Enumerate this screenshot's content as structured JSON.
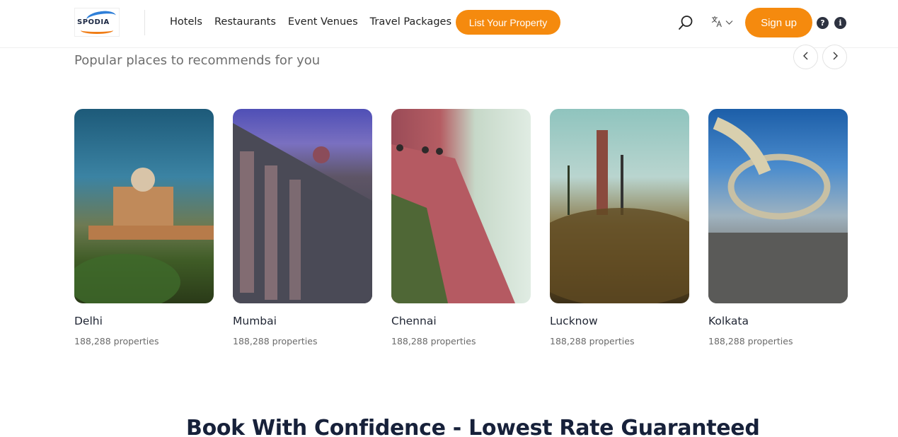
{
  "header": {
    "logo_text": "SPODIA",
    "nav": [
      "Hotels",
      "Restaurants",
      "Event Venues",
      "Travel Packages"
    ],
    "list_property_label": "List Your Property",
    "signup_label": "Sign up",
    "help_glyph": "?",
    "info_glyph": "i"
  },
  "section": {
    "title": "Popular places to recommends for you",
    "cards": [
      {
        "name": "Delhi",
        "count": "188,288 properties"
      },
      {
        "name": "Mumbai",
        "count": "188,288 properties"
      },
      {
        "name": "Chennai",
        "count": "188,288 properties"
      },
      {
        "name": "Lucknow",
        "count": "188,288 properties"
      },
      {
        "name": "Kolkata",
        "count": "188,288 properties"
      }
    ]
  },
  "bottom": {
    "title": "Book With Confidence - Lowest Rate Guaranteed"
  },
  "colors": {
    "accent": "#f58a0e",
    "text_dark": "#1f2533"
  },
  "icons": [
    "search-icon",
    "translate-icon",
    "chevron-down-icon",
    "help-icon",
    "info-icon",
    "chevron-left-icon",
    "chevron-right-icon"
  ]
}
